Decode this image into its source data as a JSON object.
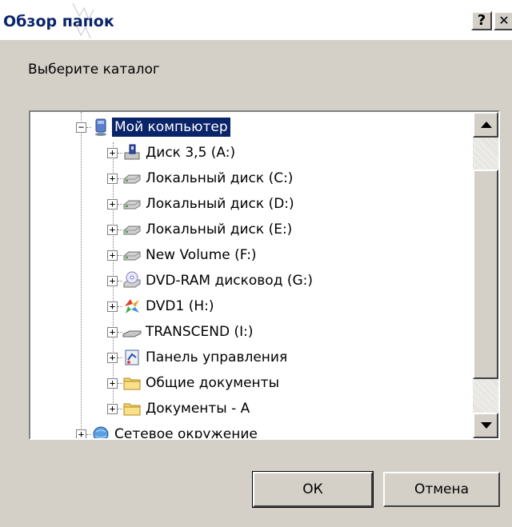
{
  "window": {
    "title": "Обзор папок",
    "help_glyph": "?",
    "close_glyph": "✕"
  },
  "prompt": "Выберите каталог",
  "tree": {
    "items": [
      {
        "label": "Мой компьютер",
        "icon": "my-computer-icon",
        "expander": "−",
        "selected": true
      },
      {
        "label": "Диск 3,5 (A:)",
        "icon": "floppy-drive-icon",
        "expander": "+"
      },
      {
        "label": "Локальный диск (C:)",
        "icon": "hard-drive-icon",
        "expander": "+"
      },
      {
        "label": "Локальный диск (D:)",
        "icon": "hard-drive-icon",
        "expander": "+"
      },
      {
        "label": "Локальный диск (E:)",
        "icon": "hard-drive-icon",
        "expander": "+"
      },
      {
        "label": "New Volume (F:)",
        "icon": "hard-drive-icon",
        "expander": "+"
      },
      {
        "label": "DVD-RAM дисковод (G:)",
        "icon": "dvd-drive-icon",
        "expander": "+"
      },
      {
        "label": "DVD1 (H:)",
        "icon": "dvd-disc-icon",
        "expander": "+"
      },
      {
        "label": "TRANSCEND (I:)",
        "icon": "removable-drive-icon",
        "expander": "+"
      },
      {
        "label": "Панель управления",
        "icon": "control-panel-icon",
        "expander": "+"
      },
      {
        "label": "Общие документы",
        "icon": "folder-icon",
        "expander": "+"
      },
      {
        "label": "Документы - А",
        "icon": "folder-icon",
        "expander": "+"
      },
      {
        "label": "Сетевое окружение",
        "icon": "network-icon",
        "expander": "+"
      }
    ]
  },
  "buttons": {
    "ok": "ОК",
    "cancel": "Отмена"
  },
  "colors": {
    "dialog_bg": "#d4d0c8",
    "selection": "#0a246a",
    "title_text": "#0a246a"
  }
}
